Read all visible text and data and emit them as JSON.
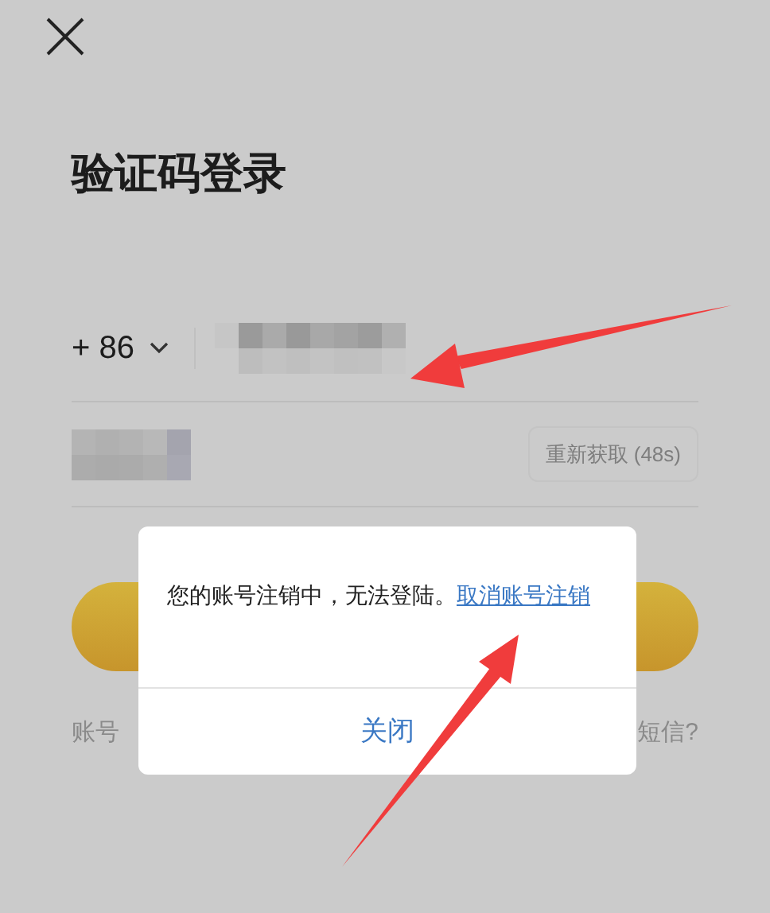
{
  "title": "验证码登录",
  "phone": {
    "country_code": "+ 86"
  },
  "code": {
    "resend_button": {
      "label": "重新获取 (48s)",
      "disabled": true
    }
  },
  "footer": {
    "left": "账号",
    "right": "短信?"
  },
  "dialog": {
    "message": "您的账号注销中，无法登陆。",
    "link": "取消账号注销",
    "button": "关闭"
  }
}
